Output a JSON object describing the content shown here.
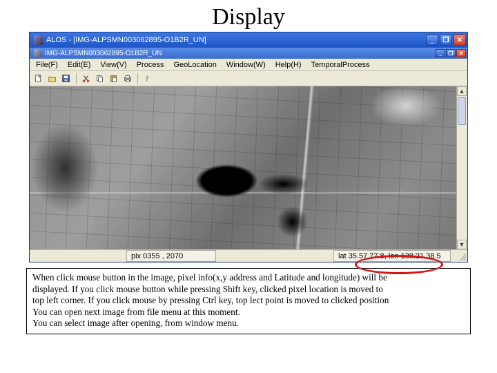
{
  "slide": {
    "title": "Display"
  },
  "window": {
    "title": "ALOS - [IMG-ALPSMN003062895-O1B2R_UN]",
    "mdi_title": "IMG-ALPSMN003062895-O1B2R_UN"
  },
  "menu": {
    "file": "File(F)",
    "edit": "Edit(E)",
    "view": "View(V)",
    "process": "Process",
    "geolocation": "GeoLocation",
    "window": "Window(W)",
    "help": "Help(H)",
    "temporal": "TemporalProcess"
  },
  "toolbar_icons": {
    "new": "new-icon",
    "open": "open-icon",
    "save": "save-icon",
    "cut": "cut-icon",
    "copy": "copy-icon",
    "paste": "paste-icon",
    "print": "print-icon",
    "help": "help-icon"
  },
  "status": {
    "pix_label": "pix",
    "pix_x": "0355",
    "pix_y": "2070",
    "lat_label": "lat",
    "lat_val": "35.57.77.8",
    "lon_label": "lon",
    "lon_val": "138.21.38.5"
  },
  "description": {
    "l1": "When click mouse button in the image, pixel info(x,y address and Latitude and longitude) will be",
    "l2": "displayed. If you click mouse button while pressing Shift key, clicked pixel location is moved to",
    "l3": "top left corner. If you click mouse by pressing Ctrl key, top lect point is moved to clicked position",
    "l4": "You can open next image from file menu at this moment.",
    "l5": "You can select image after opening, from window menu."
  }
}
